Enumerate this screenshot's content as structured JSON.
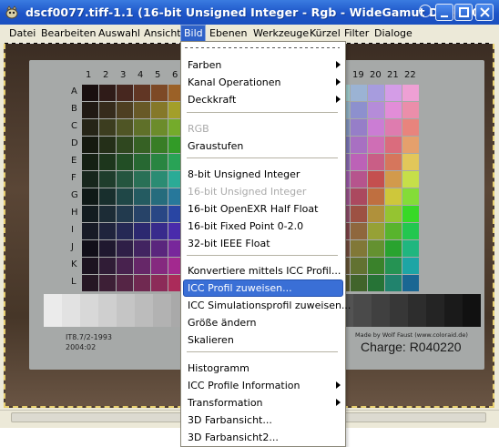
{
  "window": {
    "title": "dscf0077.tiff-1.1 (16-bit Unsigned Integer - Rgb - WideGamut D65) 20%"
  },
  "menubar": {
    "items": [
      "Datei",
      "Bearbeiten",
      "Auswahl",
      "Ansicht",
      "Bild",
      "Ebenen",
      "Werkzeuge",
      "Kürzel",
      "Filter",
      "Dialoge"
    ],
    "active": "Bild"
  },
  "dropdown": {
    "farben": "Farben",
    "kanal": "Kanal Operationen",
    "deckkraft": "Deckkraft",
    "rgb": "RGB",
    "graustufen": "Graustufen",
    "bit8": "8-bit Unsigned Integer",
    "bit16": "16-bit Unsigned Integer",
    "bit16exr": "16-bit OpenEXR Half Float",
    "bit16fixed": "16-bit Fixed Point 0-2.0",
    "bit32": "32-bit IEEE Float",
    "konvertiere": "Konvertiere mittels ICC Profil...",
    "icc_zuweisen": "ICC Profil zuweisen...",
    "icc_sim": "ICC Simulationsprofil zuweisen...",
    "groesse": "Größe ändern",
    "skalieren": "Skalieren",
    "histogramm": "Histogramm",
    "icc_info": "ICC Profile Information",
    "transformation": "Transformation",
    "farb3d": "3D Farbansicht...",
    "farb3d2": "3D Farbansicht2..."
  },
  "photo": {
    "col_numbers": [
      "1",
      "2",
      "3",
      "4",
      "5",
      "6",
      "7"
    ],
    "row_letters": [
      "A",
      "B",
      "C",
      "D",
      "E",
      "F",
      "G",
      "H",
      "I",
      "J",
      "K",
      "L"
    ],
    "right_col_numbers": [
      "18",
      "19",
      "20",
      "21",
      "22"
    ],
    "chart_id": "IT8.7/2-1993",
    "chart_date": "2004:02",
    "made_by": "Made by Wolf Faust (www.coloraid.de)",
    "charge": "Charge: R040220"
  },
  "colors": {
    "titlebar": "#245ec9",
    "menu_highlight": "#3a6fd6",
    "chart_background": "#a6a9a8"
  }
}
